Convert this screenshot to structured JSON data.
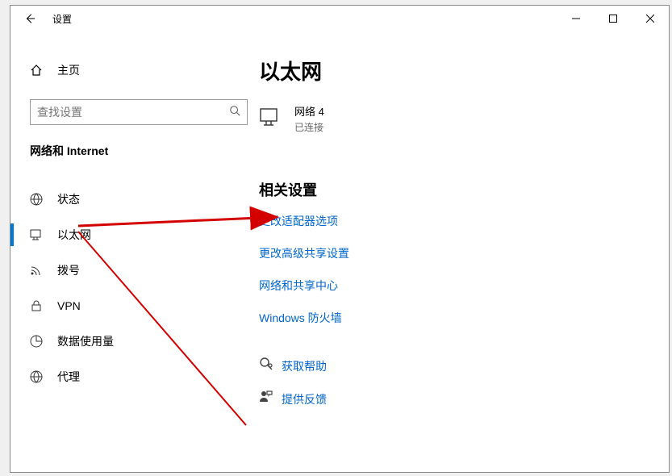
{
  "window": {
    "title": "设置"
  },
  "sidebar": {
    "home": "主页",
    "searchPlaceholder": "查找设置",
    "category": "网络和 Internet",
    "items": [
      {
        "label": "状态"
      },
      {
        "label": "以太网"
      },
      {
        "label": "拨号"
      },
      {
        "label": "VPN"
      },
      {
        "label": "数据使用量"
      },
      {
        "label": "代理"
      }
    ]
  },
  "main": {
    "title": "以太网",
    "network": {
      "name": "网络 4",
      "state": "已连接"
    },
    "relatedHead": "相关设置",
    "links": [
      "更改适配器选项",
      "更改高级共享设置",
      "网络和共享中心",
      "Windows 防火墙"
    ],
    "help": "获取帮助",
    "feedback": "提供反馈"
  }
}
